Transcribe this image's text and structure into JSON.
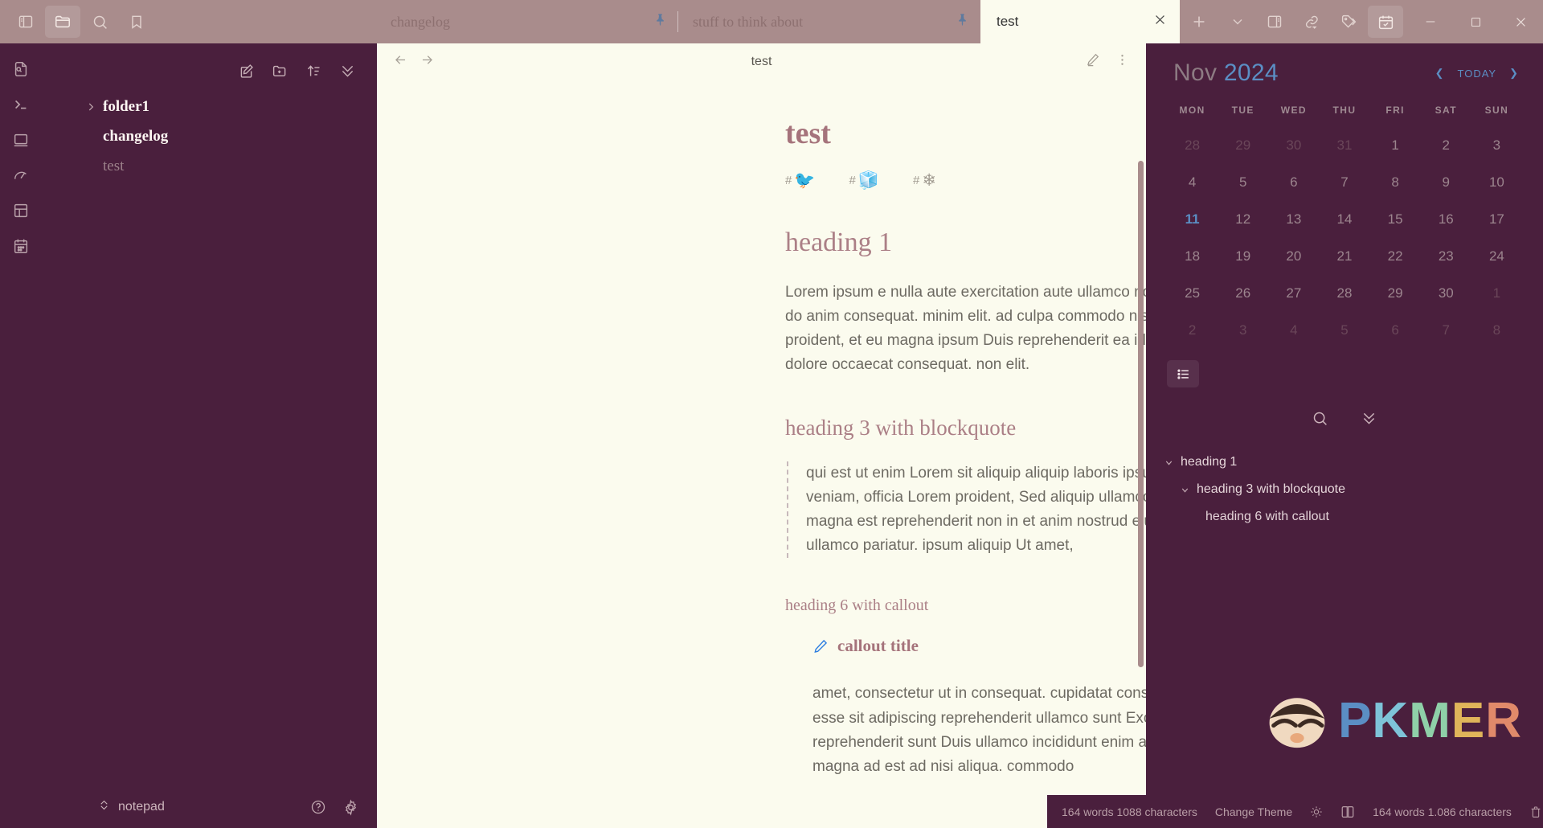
{
  "titlebar": {
    "left_icons": [
      {
        "name": "toggle-left-sidebar-icon",
        "label": "Toggle left sidebar"
      },
      {
        "name": "folder-icon",
        "label": "Files"
      },
      {
        "name": "search-icon",
        "label": "Search"
      },
      {
        "name": "bookmark-icon",
        "label": "Bookmarks"
      }
    ],
    "tabs": [
      {
        "label": "changelog",
        "active": false,
        "pinned": true
      },
      {
        "label": "stuff to think about",
        "active": false,
        "pinned": true
      },
      {
        "label": "test",
        "active": true,
        "pinned": false
      }
    ],
    "new_tab_label": "+",
    "tab_list_label": "⌄",
    "right_icons": [
      {
        "name": "toggle-right-sidebar-icon",
        "label": "Toggle right sidebar"
      },
      {
        "name": "link-share-icon",
        "label": "Links"
      },
      {
        "name": "tags-icon",
        "label": "Tags"
      },
      {
        "name": "calendar-check-icon",
        "label": "Calendar",
        "active": true
      }
    ],
    "window_controls": [
      {
        "name": "minimize-button",
        "label": "—"
      },
      {
        "name": "maximize-button",
        "label": "▢"
      },
      {
        "name": "close-button",
        "label": "✕"
      }
    ]
  },
  "ribbon": {
    "icons": [
      {
        "name": "file-search-icon",
        "label": "Quick switcher"
      },
      {
        "name": "terminal-icon",
        "label": "Terminal"
      },
      {
        "name": "window-icon",
        "label": "Window"
      },
      {
        "name": "gauge-icon",
        "label": "Dashboard"
      },
      {
        "name": "layout-icon",
        "label": "Layout"
      },
      {
        "name": "calendar-icon",
        "label": "Calendar"
      }
    ]
  },
  "explorer": {
    "toolbar": [
      {
        "name": "new-note-icon",
        "label": "New note"
      },
      {
        "name": "new-folder-icon",
        "label": "New folder"
      },
      {
        "name": "sort-icon",
        "label": "Change sort order"
      },
      {
        "name": "collapse-all-icon",
        "label": "Collapse all"
      }
    ],
    "tree": [
      {
        "label": "folder1",
        "type": "folder",
        "expanded": false
      },
      {
        "label": "changelog",
        "type": "file",
        "style": "bold"
      },
      {
        "label": "test",
        "type": "file",
        "style": "dim"
      }
    ],
    "vault_name": "notepad",
    "footer_icons": [
      {
        "name": "help-icon",
        "label": "Help"
      },
      {
        "name": "settings-gear-icon",
        "label": "Settings"
      }
    ]
  },
  "note": {
    "header": {
      "back_label": "←",
      "forward_label": "→",
      "title": "test",
      "edit_icon": "pencil-icon",
      "more_icon": "more-options-icon"
    },
    "title": "test",
    "tags": [
      {
        "hash": "#",
        "emoji": "🐦",
        "name": "tag-bird"
      },
      {
        "hash": "#",
        "emoji": "🧊",
        "name": "tag-ice"
      },
      {
        "hash": "#",
        "emoji": "❄",
        "name": "tag-snowflake"
      }
    ],
    "heading1": "heading 1",
    "paragraph1": "Lorem ipsum e nulla aute exercitation aute ullamco non deserunt occaecat adipiscing Sed Excepteur do anim consequat. minim elit. ad culpa commodo nisi dolore dolore irure cupidatat Lorem ad proident, et eu magna ipsum Duis reprehenderit ea id ipsum eu aliquip do Ut fugiat laboris cupidatat dolore occaecat consequat. non elit.",
    "heading3": "heading 3 with blockquote",
    "blockquote": "qui est ut enim Lorem sit aliquip aliquip laboris ipsum commodo Duis irure est laboris ullamco veniam, officia Lorem proident, Sed aliquip ullamco Ut do irure commodo nostrud sit commodo magna est reprehenderit non in et anim nostrud eiusmod irure consectetur sunt labore eiusmod ullamco pariatur. ipsum aliquip Ut amet,",
    "heading6": "heading 6 with callout",
    "callout_title": "callout title",
    "callout_body": "amet, consectetur ut in consequat. cupidatat consectetur ut dolore ipsum amet, sit ea officia enim esse sit adipiscing reprehenderit ullamco sunt Excepteur dolore proident, ipsum in eu aute reprehenderit sunt Duis ullamco incididunt enim adipiscing amet, do est eiusmod est magna do ut magna ad est ad nisi aliqua. commodo"
  },
  "calendar": {
    "month": "Nov",
    "year": "2024",
    "prev_label": "❮",
    "today_label": "TODAY",
    "next_label": "❯",
    "dow": [
      "MON",
      "TUE",
      "WED",
      "THU",
      "FRI",
      "SAT",
      "SUN"
    ],
    "weeks": [
      [
        {
          "d": "28",
          "o": true
        },
        {
          "d": "29",
          "o": true
        },
        {
          "d": "30",
          "o": true
        },
        {
          "d": "31",
          "o": true
        },
        {
          "d": "1"
        },
        {
          "d": "2"
        },
        {
          "d": "3"
        }
      ],
      [
        {
          "d": "4"
        },
        {
          "d": "5"
        },
        {
          "d": "6"
        },
        {
          "d": "7"
        },
        {
          "d": "8"
        },
        {
          "d": "9"
        },
        {
          "d": "10"
        }
      ],
      [
        {
          "d": "11",
          "t": true
        },
        {
          "d": "12"
        },
        {
          "d": "13"
        },
        {
          "d": "14"
        },
        {
          "d": "15"
        },
        {
          "d": "16"
        },
        {
          "d": "17"
        }
      ],
      [
        {
          "d": "18"
        },
        {
          "d": "19"
        },
        {
          "d": "20"
        },
        {
          "d": "21"
        },
        {
          "d": "22"
        },
        {
          "d": "23"
        },
        {
          "d": "24"
        }
      ],
      [
        {
          "d": "25"
        },
        {
          "d": "26"
        },
        {
          "d": "27"
        },
        {
          "d": "28"
        },
        {
          "d": "29"
        },
        {
          "d": "30"
        },
        {
          "d": "1",
          "o": true
        }
      ],
      [
        {
          "d": "2",
          "o": true
        },
        {
          "d": "3",
          "o": true
        },
        {
          "d": "4",
          "o": true
        },
        {
          "d": "5",
          "o": true
        },
        {
          "d": "6",
          "o": true
        },
        {
          "d": "7",
          "o": true
        },
        {
          "d": "8",
          "o": true
        }
      ]
    ],
    "mode_icon": "list-view-icon"
  },
  "outline": {
    "tools": [
      {
        "name": "outline-search-icon",
        "label": "Search"
      },
      {
        "name": "outline-collapse-icon",
        "label": "Collapse all"
      }
    ],
    "items": [
      {
        "label": "heading 1",
        "level": 1,
        "chevron": "⌄"
      },
      {
        "label": "heading 3 with blockquote",
        "level": 2,
        "chevron": "⌄"
      },
      {
        "label": "heading 6 with callout",
        "level": 3,
        "chevron": ""
      }
    ]
  },
  "watermark": {
    "p": "P",
    "k": "K",
    "m": "M",
    "e": "E",
    "r": "R"
  },
  "statusbar": {
    "left_counts": "164 words 1088 characters",
    "theme_label": "Change Theme",
    "sun_icon": "sun-icon",
    "book_icon": "book-icon",
    "right_counts": "164 words 1.086 characters",
    "trash_icon": "trash-icon"
  },
  "colors": {
    "accent": "#5b8ec4",
    "sidebar_bg": "#4a1f3d",
    "note_bg": "#fbfbee",
    "titlebar_bg": "#a98c8c",
    "heading": "#ab7f86"
  }
}
